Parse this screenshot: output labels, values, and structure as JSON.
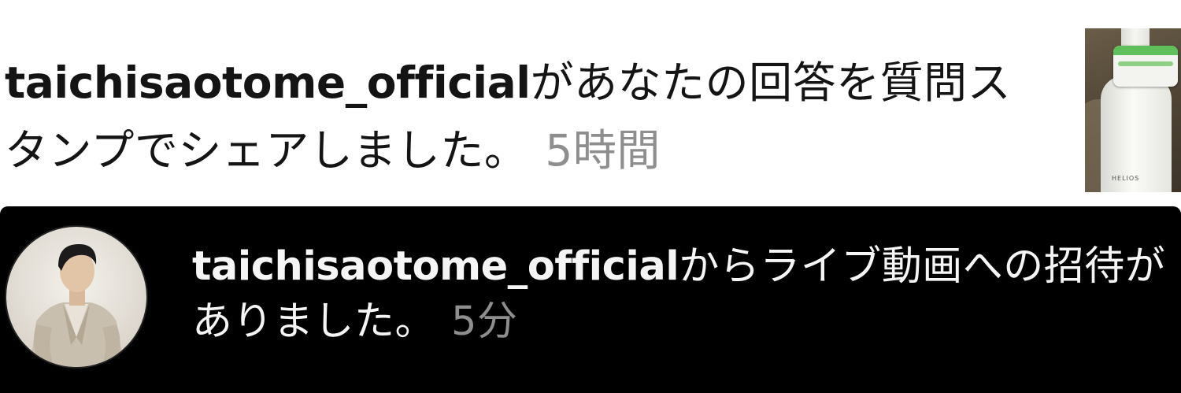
{
  "notifications": [
    {
      "username": "taichisaotome_official",
      "message": "があなたの回答を質問スタンプでシェアしました。",
      "time": "5時間",
      "thumbnail": "story-thumbnail",
      "thumbnail_brand": "HELIOS"
    },
    {
      "username": "taichisaotome_official",
      "message": "からライブ動画への招待がありました。",
      "time": "5分",
      "avatar": "profile-avatar"
    }
  ],
  "colors": {
    "light_bg": "#ffffff",
    "dark_bg": "#000000",
    "text_dark": "#141414",
    "text_light": "#f5f5f5",
    "timestamp": "#8e8e8e"
  }
}
